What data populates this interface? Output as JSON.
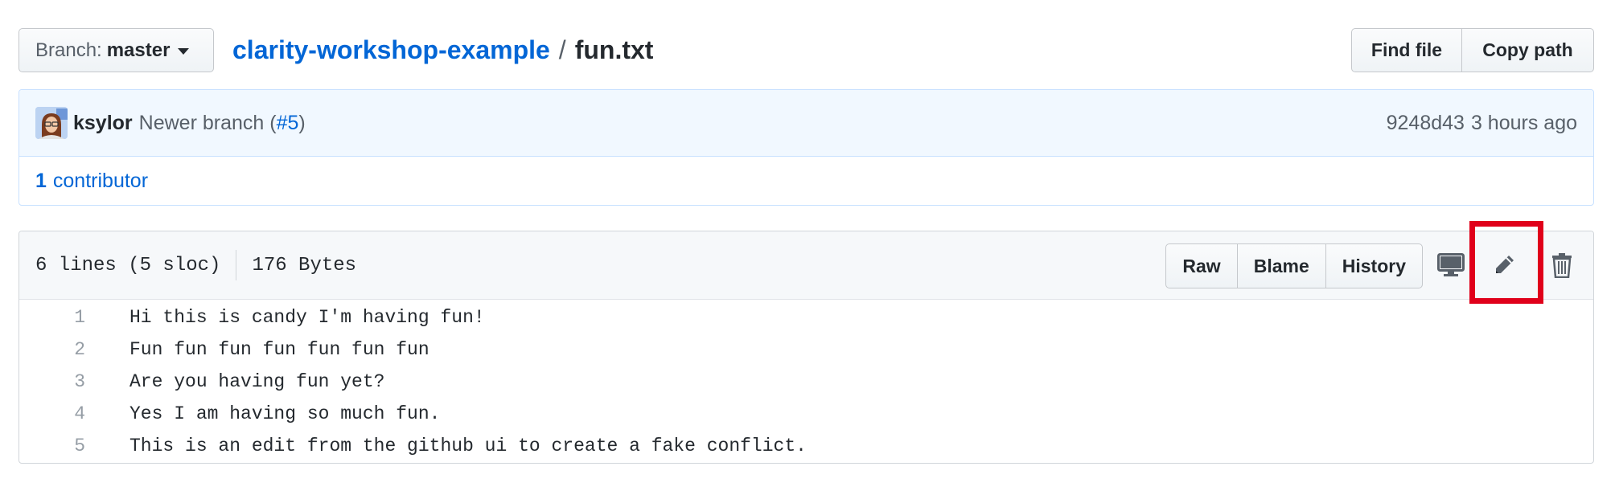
{
  "branch": {
    "label": "Branch:",
    "value": "master"
  },
  "breadcrumb": {
    "repo": "clarity-workshop-example",
    "separator": "/",
    "file": "fun.txt"
  },
  "top_actions": {
    "find_file": "Find file",
    "copy_path": "Copy path"
  },
  "commit": {
    "author": "ksylor",
    "message_prefix": "Newer branch (",
    "pr_link": "#5",
    "message_suffix": ")",
    "sha": "9248d43",
    "time": "3 hours ago"
  },
  "contributors": {
    "count": "1",
    "label": "contributor"
  },
  "file_info": {
    "lines": "6 lines (5 sloc)",
    "size": "176 Bytes"
  },
  "file_actions": {
    "raw": "Raw",
    "blame": "Blame",
    "history": "History"
  },
  "icons": {
    "desktop": "desktop-icon",
    "edit": "pencil-icon",
    "delete": "trash-icon",
    "caret": "caret-down-icon"
  },
  "colors": {
    "link": "#0366d6",
    "highlight": "#e0001a",
    "commit_bg": "#f1f8ff"
  },
  "code_lines": [
    {
      "number": "1",
      "text": "Hi this is candy I'm having fun!"
    },
    {
      "number": "2",
      "text": "Fun fun fun fun fun fun fun"
    },
    {
      "number": "3",
      "text": "Are you having fun yet?"
    },
    {
      "number": "4",
      "text": "Yes I am having so much fun."
    },
    {
      "number": "5",
      "text": "This is an edit from the github ui to create a fake conflict."
    }
  ]
}
